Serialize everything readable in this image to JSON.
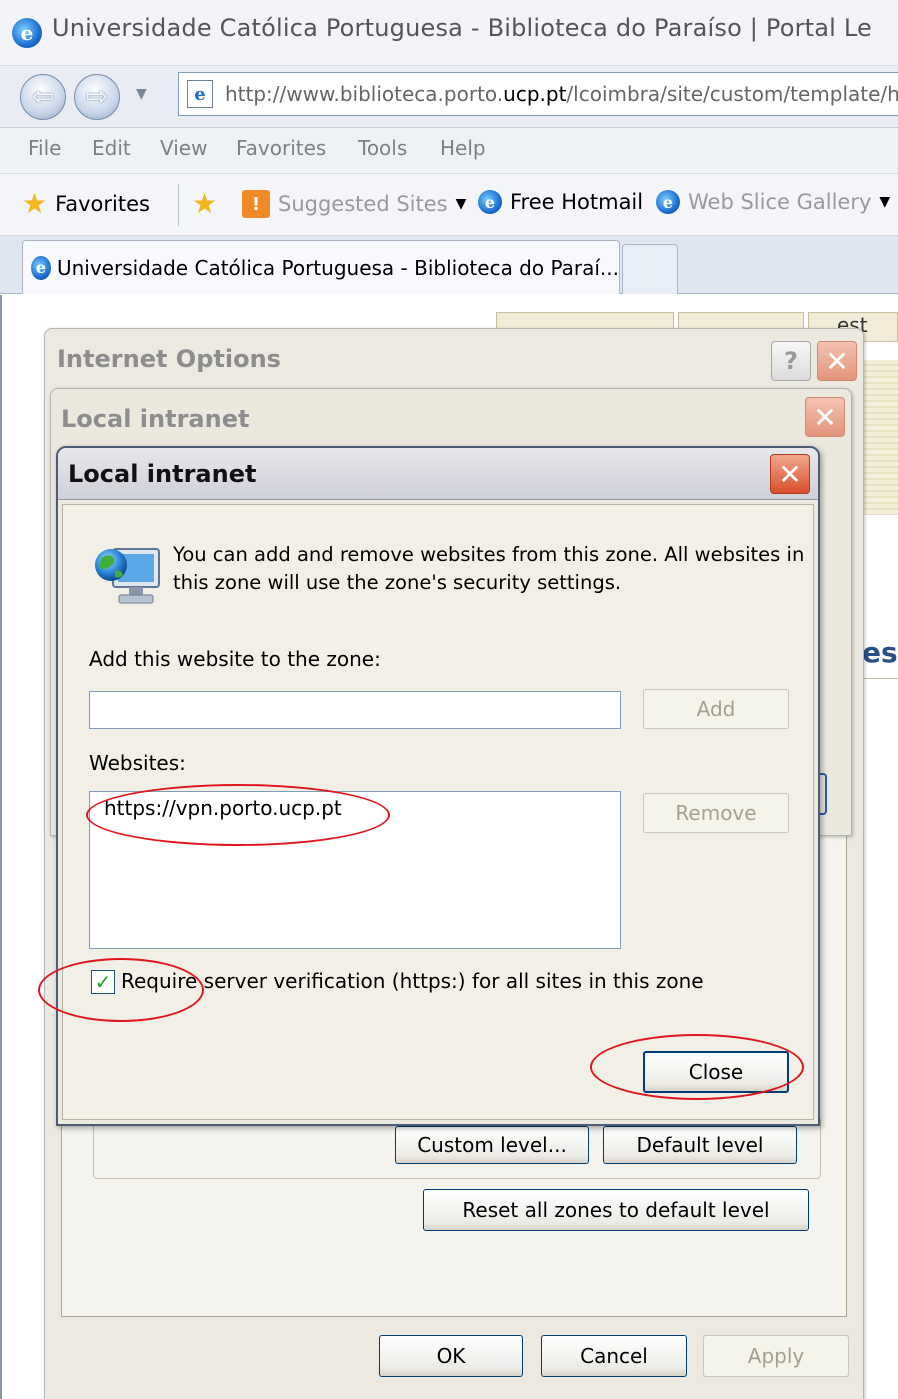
{
  "browser": {
    "window_title": "Universidade Católica Portuguesa - Biblioteca do Paraíso | Portal Le",
    "address": {
      "prefix": "http://www.biblioteca.porto.",
      "bold": "ucp.pt",
      "suffix": "/lcoimbra/site/custom/template/hor"
    },
    "menu": [
      "File",
      "Edit",
      "View",
      "Favorites",
      "Tools",
      "Help"
    ],
    "favorites_bar": {
      "favorites": "Favorites",
      "suggested_sites": "Suggested Sites",
      "free_hotmail": "Free Hotmail",
      "web_slice_gallery": "Web Slice Gallery"
    },
    "tab_title": "Universidade Católica Portuguesa - Biblioteca do Paraí..."
  },
  "background_page": {
    "tab_fragment": "est",
    "heading_fragment": "est"
  },
  "internet_options": {
    "title": "Internet Options",
    "help_glyph": "?",
    "buttons": {
      "custom_level": "Custom level...",
      "default_level": "Default level",
      "reset_all": "Reset all zones to default level",
      "ok": "OK",
      "cancel": "Cancel",
      "apply": "Apply"
    }
  },
  "local_intranet_back": {
    "title": "Local intranet"
  },
  "local_intranet_dialog": {
    "title": "Local intranet",
    "info": "You can add and remove websites from this zone. All websites in this zone will use the zone's security settings.",
    "add_label": "Add this website to the zone:",
    "add_value": "",
    "add_button": "Add",
    "websites_label": "Websites:",
    "websites": [
      "https://vpn.porto.ucp.pt"
    ],
    "remove_button": "Remove",
    "require_verification_label": "Require server verification (https:) for all sites in this zone",
    "require_verification_checked": true,
    "close_button": "Close"
  },
  "glyphs": {
    "close": "✕",
    "check": "✓",
    "back": "⇦",
    "forward": "⇨",
    "dropdown": "▼",
    "ie": "e"
  },
  "colors": {
    "annotation_red": "#e0161c",
    "close_red": "#d84f2b",
    "dialog_bg": "#ece9e0"
  }
}
